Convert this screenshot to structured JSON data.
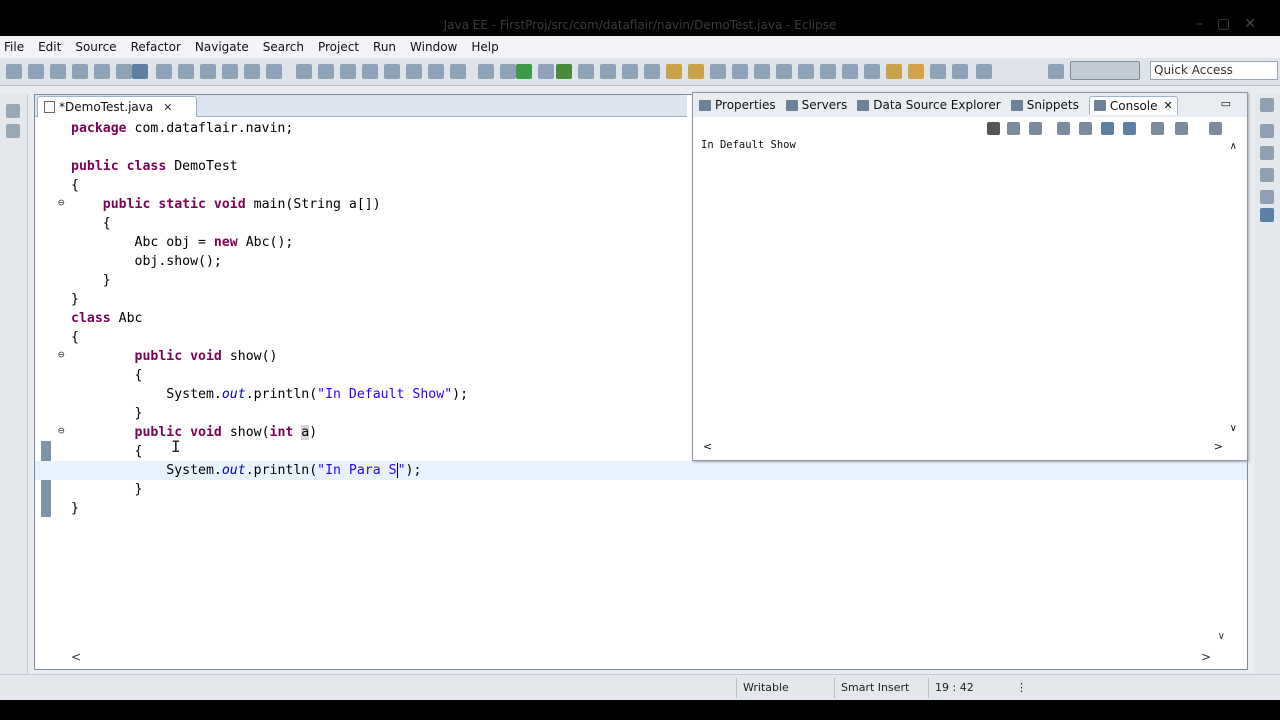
{
  "window": {
    "title": "Java EE - FirstProj/src/com/dataflair/navin/DemoTest.java - Eclipse"
  },
  "menu": [
    "File",
    "Edit",
    "Source",
    "Refactor",
    "Navigate",
    "Search",
    "Project",
    "Run",
    "Window",
    "Help"
  ],
  "toolbar": {
    "quick_access_placeholder": "Quick Access"
  },
  "editor": {
    "tab_label": "*DemoTest.java",
    "tab_close": "✕",
    "lines": [
      "package com.dataflair.navin;",
      "",
      "public class DemoTest",
      "{",
      "    public static void main(String a[])",
      "    {",
      "        Abc obj = new Abc();",
      "        obj.show();",
      "    }",
      "}",
      "class Abc",
      "{",
      "        public void show()",
      "        {",
      "            System.out.println(\"In Default Show\");",
      "        }",
      "        public void show(int a)",
      "        {",
      "            System.out.println(\"In Para S\");",
      "        }",
      "}"
    ]
  },
  "views": {
    "tabs": [
      {
        "label": "Properties",
        "icon": "properties-icon"
      },
      {
        "label": "Servers",
        "icon": "servers-icon"
      },
      {
        "label": "Data Source Explorer",
        "icon": "data-source-icon"
      },
      {
        "label": "Snippets",
        "icon": "snippets-icon"
      },
      {
        "label": "Console",
        "icon": "console-icon",
        "active": true
      }
    ],
    "console_close": "✕",
    "console_output": "In Default Show"
  },
  "status": {
    "writable": "Writable",
    "insert_mode": "Smart Insert",
    "position": "19 : 42"
  }
}
